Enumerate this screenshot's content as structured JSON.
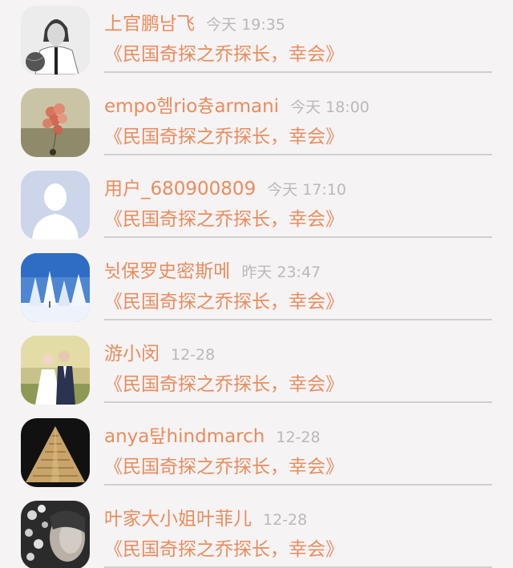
{
  "messages": [
    {
      "name": "上官鹏남飞",
      "time": "今天 19:35",
      "text": "《民国奇探之乔探长，幸会》",
      "avatar": "avatar-man-basketball"
    },
    {
      "name": "empo헴rio츙armani",
      "time": "今天 18:00",
      "text": "《民国奇探之乔探长，幸会》",
      "avatar": "avatar-balloons"
    },
    {
      "name": "用户_680900809",
      "time": "今天 17:10",
      "text": "《民国奇探之乔探长，幸会》",
      "avatar": "avatar-default-person"
    },
    {
      "name": "뉫保罗史密斯메",
      "time": "昨天 23:47",
      "text": "《民国奇探之乔探长，幸会》",
      "avatar": "avatar-snow-trees"
    },
    {
      "name": "游小闵",
      "time": "12-28",
      "text": "《民国奇探之乔探长，幸会》",
      "avatar": "avatar-wedding-couple"
    },
    {
      "name": "anya탚hindmarch",
      "time": "12-28",
      "text": "《民国奇探之乔探长，幸会》",
      "avatar": "avatar-pyramid"
    },
    {
      "name": "叶家大小姐叶菲儿",
      "time": "12-28",
      "text": "《民国奇探之乔探长，幸会》",
      "avatar": "avatar-woman-flowers"
    }
  ]
}
